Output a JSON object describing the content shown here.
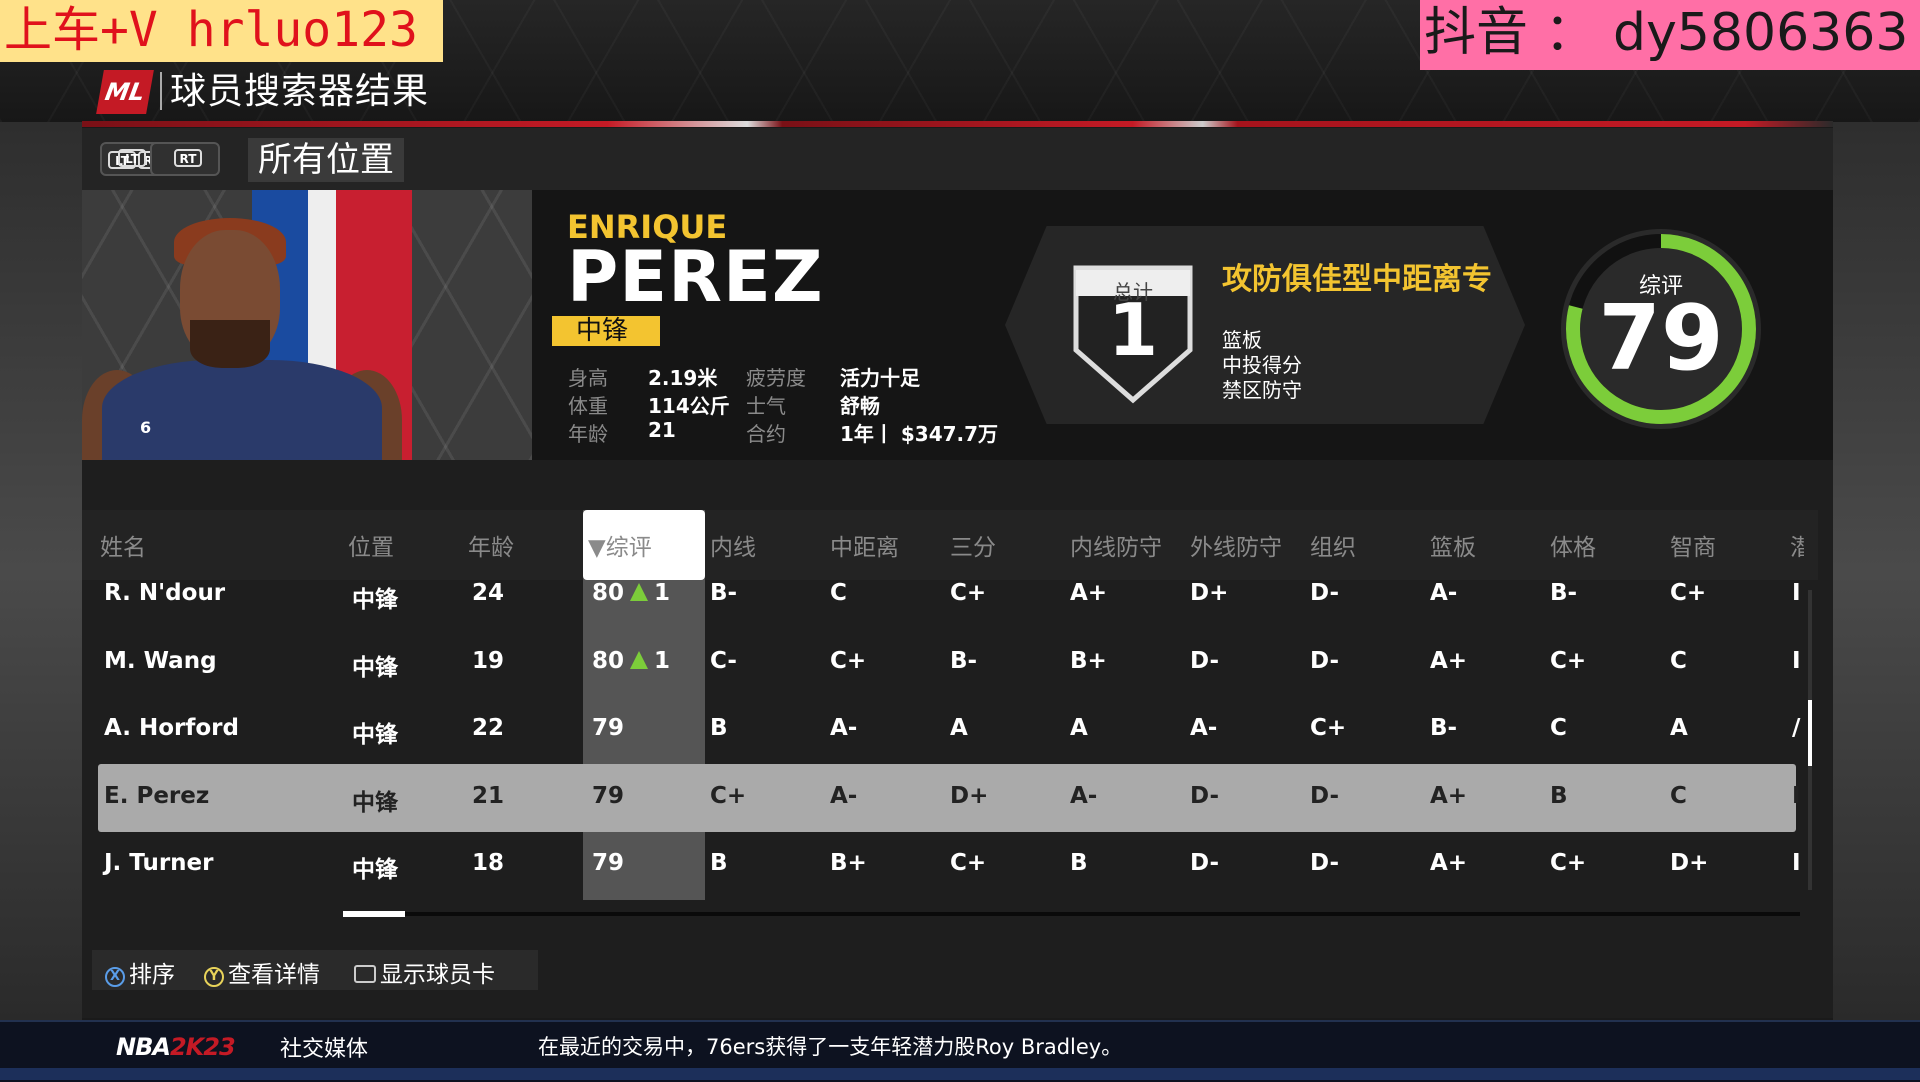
{
  "watermarks": {
    "left": "上车+V  hrluo123",
    "right": "抖音 ： dy5806363"
  },
  "header": {
    "logo": "ML",
    "title": "球员搜索器结果"
  },
  "filters": {
    "lt": "LT",
    "rt": "RT",
    "position": "所有位置"
  },
  "player": {
    "first_name": "ENRIQUE",
    "last_name": "PEREZ",
    "position": "中锋",
    "jersey": "6",
    "attributes": [
      {
        "label": "身高",
        "value": "2.19米"
      },
      {
        "label": "体重",
        "value": "114公斤"
      },
      {
        "label": "年龄",
        "value": "21"
      },
      {
        "label": "疲劳度",
        "value": "活力十足"
      },
      {
        "label": "士气",
        "value": "舒畅"
      },
      {
        "label": "合约",
        "value": "1年丨 $347.7万"
      }
    ],
    "archetype": {
      "total_label": "总计",
      "total_value": "1",
      "title": "攻防俱佳型中距离专",
      "skills": [
        "篮板",
        "中投得分",
        "禁区防守"
      ]
    },
    "overall": {
      "label": "综评",
      "value": "79",
      "ring_fraction": 0.79,
      "ring_color": "#7ccd3a"
    }
  },
  "table": {
    "columns": [
      "姓名",
      "位置",
      "年龄",
      "▼综评",
      "内线",
      "中距离",
      "三分",
      "内线防守",
      "外线防守",
      "组织",
      "篮板",
      "体格",
      "智商",
      "潜"
    ],
    "sorted_column": "▼综评",
    "rows": [
      {
        "name": "R. N'dour",
        "pos": "中锋",
        "age": "24",
        "ovr": "80",
        "delta": "1",
        "grades": [
          "B-",
          "C",
          "C+",
          "A+",
          "D+",
          "D-",
          "A-",
          "B-",
          "C+",
          "I"
        ],
        "selected": false
      },
      {
        "name": "M. Wang",
        "pos": "中锋",
        "age": "19",
        "ovr": "80",
        "delta": "1",
        "grades": [
          "C-",
          "C+",
          "B-",
          "B+",
          "D-",
          "D-",
          "A+",
          "C+",
          "C",
          "I"
        ],
        "selected": false
      },
      {
        "name": "A. Horford",
        "pos": "中锋",
        "age": "22",
        "ovr": "79",
        "delta": "",
        "grades": [
          "B",
          "A-",
          "A",
          "A",
          "A-",
          "C+",
          "B-",
          "C",
          "A",
          "/"
        ],
        "selected": false
      },
      {
        "name": "E. Perez",
        "pos": "中锋",
        "age": "21",
        "ovr": "79",
        "delta": "",
        "grades": [
          "C+",
          "A-",
          "D+",
          "A-",
          "D-",
          "D-",
          "A+",
          "B",
          "C",
          "I"
        ],
        "selected": true
      },
      {
        "name": "J. Turner",
        "pos": "中锋",
        "age": "18",
        "ovr": "79",
        "delta": "",
        "grades": [
          "B",
          "B+",
          "C+",
          "B",
          "D-",
          "D-",
          "A+",
          "C+",
          "D+",
          "I"
        ],
        "selected": false
      }
    ]
  },
  "controls": {
    "x_icon": "X",
    "sort": "排序",
    "y_icon": "Y",
    "details": "查看详情",
    "card": "显示球员卡"
  },
  "ticker": {
    "logo_nba": "NBA",
    "logo_2k": "2K23",
    "category": "社交媒体",
    "text": "在最近的交易中，76ers获得了一支年轻潜力股Roy Bradley。"
  }
}
